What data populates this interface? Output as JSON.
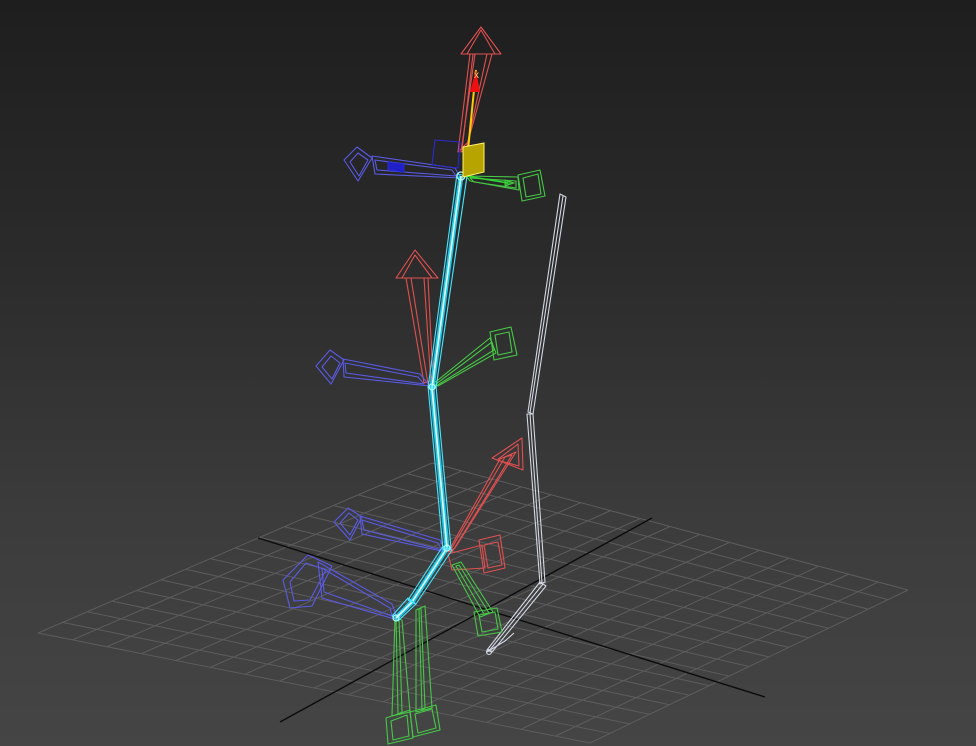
{
  "viewport": {
    "grid_color": "#5c5c5c",
    "axis_color": "#0c0c0c",
    "selected_bone_color": "#46e6ff",
    "helper_chain_color": "#d2d8e4",
    "x_axis_color": "#e05050",
    "y_axis_color": "#46c846",
    "z_axis_color": "#5a5ae6",
    "gizmo_x_label": "x"
  }
}
